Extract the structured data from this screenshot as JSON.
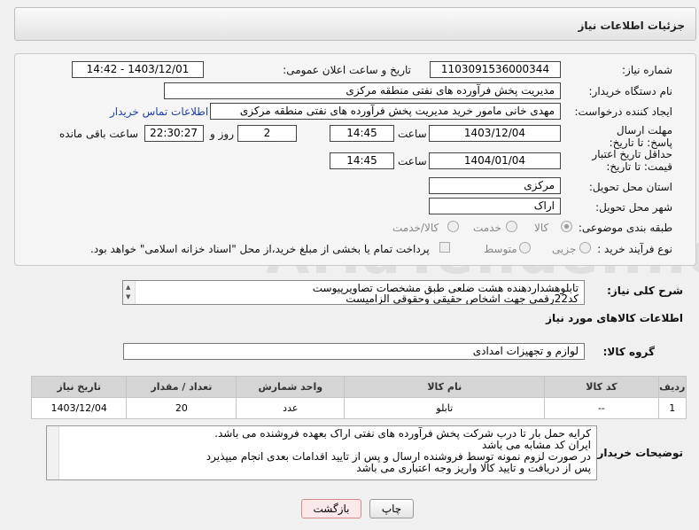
{
  "header": {
    "title": "جزئیات اطلاعات نیاز"
  },
  "form": {
    "need_number_label": "شماره نیاز:",
    "need_number": "1103091536000344",
    "announce_label": "تاریخ و ساعت اعلان عمومی:",
    "announce_value": "1403/12/01 - 14:42",
    "buyer_org_label": "نام دستگاه خریدار:",
    "buyer_org": "مدیریت پخش فرآورده های نفتی منطقه مرکزی",
    "creator_label": "ایجاد کننده درخواست:",
    "creator": "مهدی خانی مامور خرید مدیریت پخش فرآورده های نفتی منطقه مرکزی",
    "contact_link": "اطلاعات تماس خریدار",
    "reply_deadline_label": "مهلت ارسال پاسخ: تا تاریخ:",
    "reply_date": "1403/12/04",
    "reply_time_label": "ساعت",
    "reply_time": "14:45",
    "days_value": "2",
    "days_label": "روز و",
    "remaining_time": "22:30:27",
    "remaining_label": "ساعت باقی مانده",
    "price_validity_label": "حداقل تاریخ اعتبار قیمت: تا تاریخ:",
    "price_date": "1404/01/04",
    "price_time_label": "ساعت",
    "price_time": "14:45",
    "province_label": "استان محل تحویل:",
    "province": "مرکزی",
    "city_label": "شهر محل تحویل:",
    "city": "اراک",
    "category_label": "طبقه بندی موضوعی:",
    "category_options": [
      "کالا",
      "خدمت",
      "کالا/خدمت"
    ],
    "process_label": "نوع فرآیند خرید :",
    "process_options": [
      "جزیی",
      "متوسط"
    ],
    "payment_note": "پرداخت تمام یا بخشی از مبلغ خرید،از محل \"اسناد خزانه اسلامی\" خواهد بود."
  },
  "summary": {
    "label": "شرح کلی نیاز:",
    "line1": "تابلوهشداردهنده هشت ضلعی طبق مشخصات تصاویرپیوست",
    "line2": "کد22رقمی  جهت اشخاص حقیقی وحقوقی الزامیست"
  },
  "goods": {
    "section_title": "اطلاعات کالاهای مورد نیاز",
    "group_label": "گروه کالا:",
    "group_value": "لوازم و تجهیزات امدادی",
    "columns": [
      "ردیف",
      "کد کالا",
      "نام کالا",
      "واحد شمارش",
      "تعداد / مقدار",
      "تاریخ نیاز"
    ],
    "rows": [
      {
        "row": "1",
        "code": "--",
        "name": "تابلو",
        "unit": "عدد",
        "qty": "20",
        "date": "1403/12/04"
      }
    ]
  },
  "buyer_notes": {
    "label": "توضیحات خریدار:",
    "lines": [
      "کرایه حمل بار تا درب شرکت  پخش فرآورده های نفتی اراک بعهده فروشنده می باشد.",
      "ایران کد مشابه می باشد",
      "در صورت لزوم نمونه توسط فروشنده ارسال و پس از تایید اقدامات بعدی انجام میپذیرد",
      "پس از دریافت و تایید کالا واریز وجه اعتباری می باشد"
    ]
  },
  "buttons": {
    "print": "چاپ",
    "back": "بازگشت"
  },
  "watermark": "AriaTender.net"
}
